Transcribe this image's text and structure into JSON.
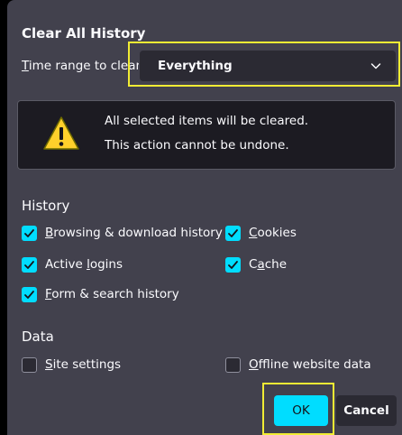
{
  "dialog": {
    "title": "Clear All History",
    "time_range": {
      "label_underlined": "T",
      "label_rest": "ime range to clear:",
      "selected": "Everything"
    },
    "warning": {
      "line1": "All selected items will be cleared.",
      "line2": "This action cannot be undone."
    },
    "history": {
      "heading": "History",
      "items": [
        {
          "underlined": "B",
          "rest": "rowsing & download history",
          "checked": true
        },
        {
          "underlined": "C",
          "rest": "ookies",
          "checked": true
        },
        {
          "before": "Active ",
          "underlined": "l",
          "rest": "ogins",
          "checked": true
        },
        {
          "before": "C",
          "underlined": "a",
          "rest": "che",
          "checked": true
        },
        {
          "underlined": "F",
          "rest": "orm & search history",
          "checked": true
        }
      ]
    },
    "data": {
      "heading": "Data",
      "items": [
        {
          "underlined": "S",
          "rest": "ite settings",
          "checked": false
        },
        {
          "underlined": "O",
          "rest": "ffline website data",
          "checked": false
        }
      ]
    },
    "buttons": {
      "ok": "OK",
      "cancel": "Cancel"
    }
  },
  "colors": {
    "dialog_bg": "#42414d",
    "accent": "#00ddff",
    "highlight": "#f1ec34",
    "warning_bg": "#1c1b22"
  },
  "icons": {
    "warning": "warning-triangle-icon",
    "dropdown": "chevron-down-icon",
    "check": "checkmark-icon"
  }
}
